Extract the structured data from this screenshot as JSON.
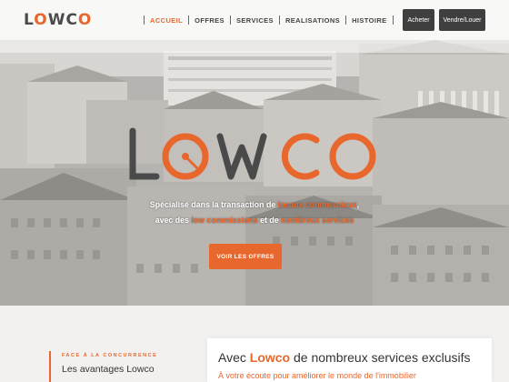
{
  "header": {
    "logo_text": "LOWCO",
    "nav": [
      {
        "label": "Accueil",
        "active": true
      },
      {
        "label": "Offres",
        "active": false
      },
      {
        "label": "Services",
        "active": false
      },
      {
        "label": "Realisations",
        "active": false
      },
      {
        "label": "Histoire",
        "active": false
      }
    ],
    "buttons": {
      "buy": "Acheter",
      "sell_rent": "Vendre/Louer"
    }
  },
  "hero": {
    "logo_text": "LOWCO",
    "tagline_line1_start": "Spécialisé dans la transaction de ",
    "tagline_line1_hl": "locaux commerciaux",
    "tagline_line1_end": ",",
    "tagline_line2_start": "avec des ",
    "tagline_line2_hl1": "low commissions",
    "tagline_line2_mid": " et de ",
    "tagline_line2_hl2": "nombreux services",
    "cta_label": "Voir les offres"
  },
  "advantages": {
    "kicker": "FACE À LA CONCURRENCE",
    "title": "Les avantages Lowco"
  },
  "services_card": {
    "title_start": "Avec ",
    "title_hl": "Lowco",
    "title_end": " de nombreux services exclusifs",
    "subtitle": "À votre écoute pour améliorer le monde de l'immobilier"
  },
  "colors": {
    "accent": "#e8672d",
    "dark_button": "#3f3f3f",
    "text": "#333333"
  },
  "icons": [
    "logo-o-icon"
  ]
}
